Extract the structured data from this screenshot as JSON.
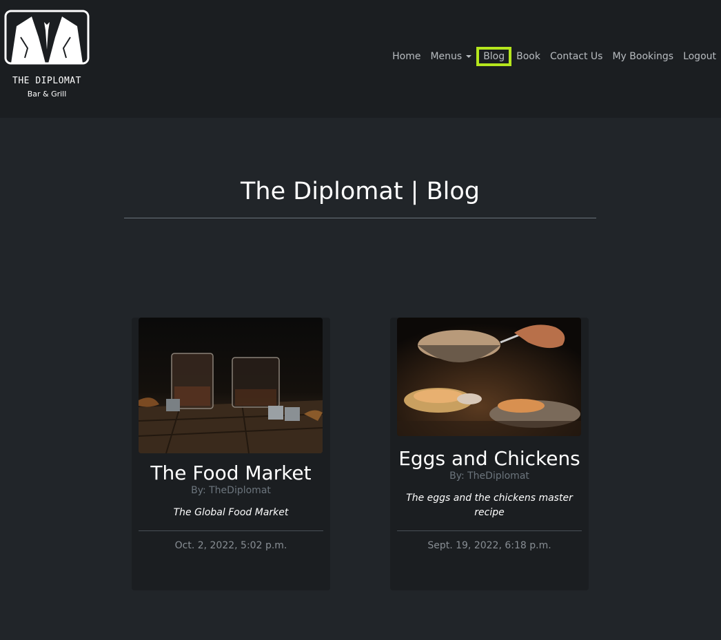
{
  "brand": {
    "name": "THE DIPLOMAT",
    "subtitle": "Bar & Grill"
  },
  "nav": {
    "items": [
      {
        "label": "Home"
      },
      {
        "label": "Menus"
      },
      {
        "label": "Blog"
      },
      {
        "label": "Book"
      },
      {
        "label": "Contact Us"
      },
      {
        "label": "My Bookings"
      },
      {
        "label": "Logout"
      }
    ],
    "active": "Blog"
  },
  "page": {
    "title": "The Diplomat | Blog"
  },
  "posts": [
    {
      "title": "The Food Market",
      "author": "By: TheDiplomat",
      "excerpt": "The Global Food Market",
      "date": "Oct. 2, 2022, 5:02 p.m.",
      "image": "whiskey-glasses-photo"
    },
    {
      "title": "Eggs and Chickens",
      "author": "By: TheDiplomat",
      "excerpt": "The eggs and the chickens master recipe",
      "date": "Sept. 19, 2022, 6:18 p.m.",
      "image": "chef-cooking-photo"
    }
  ],
  "colors": {
    "background": "#212529",
    "navbar": "#1b1e21",
    "active_highlight": "#b5e61d"
  }
}
